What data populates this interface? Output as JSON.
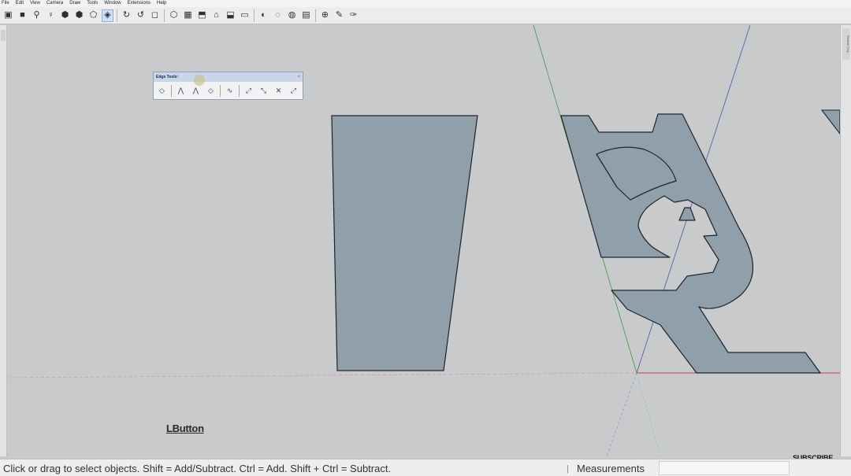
{
  "menu": [
    "File",
    "Edit",
    "View",
    "Camera",
    "Draw",
    "Tools",
    "Window",
    "Extensions",
    "Help"
  ],
  "toolbar_icons": [
    {
      "name": "save-icon",
      "glyph": "▣"
    },
    {
      "name": "camera-icon",
      "glyph": "■"
    },
    {
      "name": "search-icon",
      "glyph": "⚲"
    },
    {
      "name": "figure-icon",
      "glyph": "♀"
    },
    {
      "name": "cube-icon",
      "glyph": "⬢"
    },
    {
      "name": "cube-solid-icon",
      "glyph": "⬢"
    },
    {
      "name": "shape-icon",
      "glyph": "⬠"
    },
    {
      "name": "layers-icon",
      "glyph": "◈",
      "active": true
    },
    {
      "name": "sep"
    },
    {
      "name": "orbit-icon",
      "glyph": "↻"
    },
    {
      "name": "pan-icon",
      "glyph": "↺"
    },
    {
      "name": "zoom-window-icon",
      "glyph": "◻"
    },
    {
      "name": "sep"
    },
    {
      "name": "iso-view-icon",
      "glyph": "⬡"
    },
    {
      "name": "top-view-icon",
      "glyph": "▦"
    },
    {
      "name": "front-view-icon",
      "glyph": "⬒"
    },
    {
      "name": "home-view-icon",
      "glyph": "⌂"
    },
    {
      "name": "back-view-icon",
      "glyph": "⬓"
    },
    {
      "name": "left-view-icon",
      "glyph": "▭"
    },
    {
      "name": "sep"
    },
    {
      "name": "shadows-icon",
      "glyph": "◐"
    },
    {
      "name": "fog-icon",
      "glyph": "◌"
    },
    {
      "name": "style-icon",
      "glyph": "◍"
    },
    {
      "name": "display-icon",
      "glyph": "▤"
    },
    {
      "name": "sep"
    },
    {
      "name": "section-icon",
      "glyph": "⊕"
    },
    {
      "name": "paint-icon",
      "glyph": "✎"
    },
    {
      "name": "eraser-icon",
      "glyph": "✑"
    }
  ],
  "edge_tools": {
    "title": "Edge Tools²",
    "close": "×",
    "icons": [
      {
        "name": "edge-divide-icon",
        "glyph": "◇"
      },
      {
        "name": "sep"
      },
      {
        "name": "edge-split-icon",
        "glyph": "⋀"
      },
      {
        "name": "edge-merge-icon",
        "glyph": "⋀"
      },
      {
        "name": "edge-angle-icon",
        "glyph": "◇"
      },
      {
        "name": "sep"
      },
      {
        "name": "edge-curve-icon",
        "glyph": "∿"
      },
      {
        "name": "sep"
      },
      {
        "name": "edge-extend-icon",
        "glyph": "⤢"
      },
      {
        "name": "edge-trim-icon",
        "glyph": "⤡"
      },
      {
        "name": "edge-cross-icon",
        "glyph": "✕"
      },
      {
        "name": "edge-connect-icon",
        "glyph": "⤢"
      }
    ]
  },
  "overlay": {
    "lbutton": "LButton",
    "subscribe": "SUBSCRIBE"
  },
  "status": {
    "hint": "Click or drag to select objects. Shift = Add/Subtract. Ctrl = Add. Shift + Ctrl = Subtract.",
    "divider": "|",
    "measurements_label": "Measurements"
  },
  "tray": {
    "right_tab": "Default Tray"
  },
  "colors": {
    "face": "#8fa0ab",
    "background": "#c9cacc",
    "axis_red": "#d23a3a",
    "axis_green": "#3f9a4a",
    "axis_blue": "#4655b8"
  }
}
